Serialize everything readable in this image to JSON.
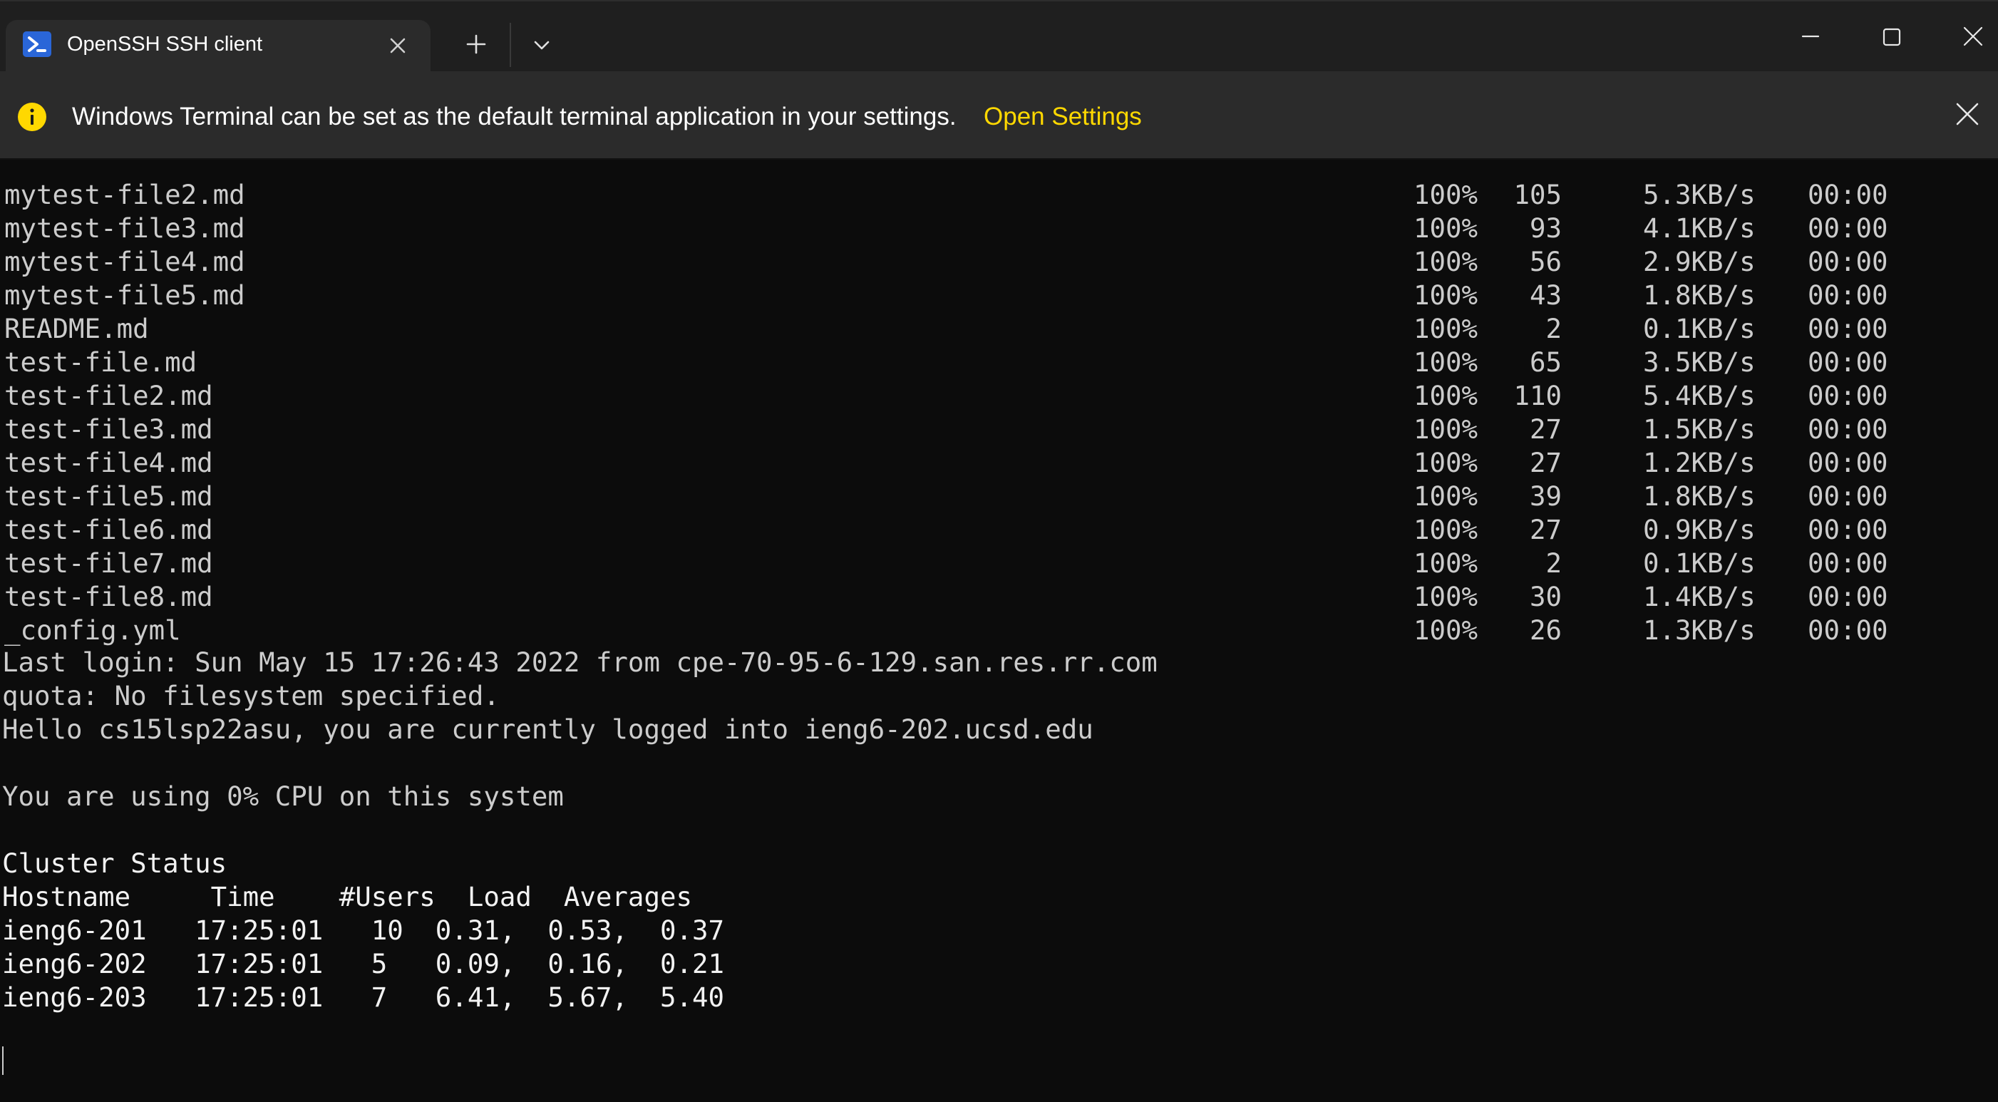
{
  "tab": {
    "title": "OpenSSH SSH client",
    "icon": "powershell-icon"
  },
  "info_bar": {
    "message": "Windows Terminal can be set as the default terminal application in your settings.",
    "link": "Open Settings",
    "icon": "info-icon"
  },
  "colors": {
    "background": "#0c0c0c",
    "text": "#cccccc",
    "accent": "#ffd800",
    "tab": "#2b2b2b"
  },
  "transfers": [
    {
      "name": "mytest-file2.md",
      "percent": "100%",
      "size": "105",
      "rate": "5.3KB/s",
      "eta": "00:00"
    },
    {
      "name": "mytest-file3.md",
      "percent": "100%",
      "size": "93",
      "rate": "4.1KB/s",
      "eta": "00:00"
    },
    {
      "name": "mytest-file4.md",
      "percent": "100%",
      "size": "56",
      "rate": "2.9KB/s",
      "eta": "00:00"
    },
    {
      "name": "mytest-file5.md",
      "percent": "100%",
      "size": "43",
      "rate": "1.8KB/s",
      "eta": "00:00"
    },
    {
      "name": "README.md",
      "percent": "100%",
      "size": "2",
      "rate": "0.1KB/s",
      "eta": "00:00"
    },
    {
      "name": "test-file.md",
      "percent": "100%",
      "size": "65",
      "rate": "3.5KB/s",
      "eta": "00:00"
    },
    {
      "name": "test-file2.md",
      "percent": "100%",
      "size": "110",
      "rate": "5.4KB/s",
      "eta": "00:00"
    },
    {
      "name": "test-file3.md",
      "percent": "100%",
      "size": "27",
      "rate": "1.5KB/s",
      "eta": "00:00"
    },
    {
      "name": "test-file4.md",
      "percent": "100%",
      "size": "27",
      "rate": "1.2KB/s",
      "eta": "00:00"
    },
    {
      "name": "test-file5.md",
      "percent": "100%",
      "size": "39",
      "rate": "1.8KB/s",
      "eta": "00:00"
    },
    {
      "name": "test-file6.md",
      "percent": "100%",
      "size": "27",
      "rate": "0.9KB/s",
      "eta": "00:00"
    },
    {
      "name": "test-file7.md",
      "percent": "100%",
      "size": "2",
      "rate": "0.1KB/s",
      "eta": "00:00"
    },
    {
      "name": "test-file8.md",
      "percent": "100%",
      "size": "30",
      "rate": "1.4KB/s",
      "eta": "00:00"
    },
    {
      "name": "_config.yml",
      "percent": "100%",
      "size": "26",
      "rate": "1.3KB/s",
      "eta": "00:00"
    }
  ],
  "login": {
    "last_login": "Last login: Sun May 15 17:26:43 2022 from cpe-70-95-6-129.san.res.rr.com",
    "quota": "quota: No filesystem specified.",
    "hello": "Hello cs15lsp22asu, you are currently logged into ieng6-202.ucsd.edu",
    "cpu": "You are using 0% CPU on this system"
  },
  "cluster": {
    "title": "Cluster Status",
    "header": "Hostname     Time    #Users  Load  Averages",
    "rows": [
      "ieng6-201   17:25:01   10  0.31,  0.53,  0.37",
      "ieng6-202   17:25:01   5   0.09,  0.16,  0.21",
      "ieng6-203   17:25:01   7   6.41,  5.67,  5.40"
    ]
  }
}
